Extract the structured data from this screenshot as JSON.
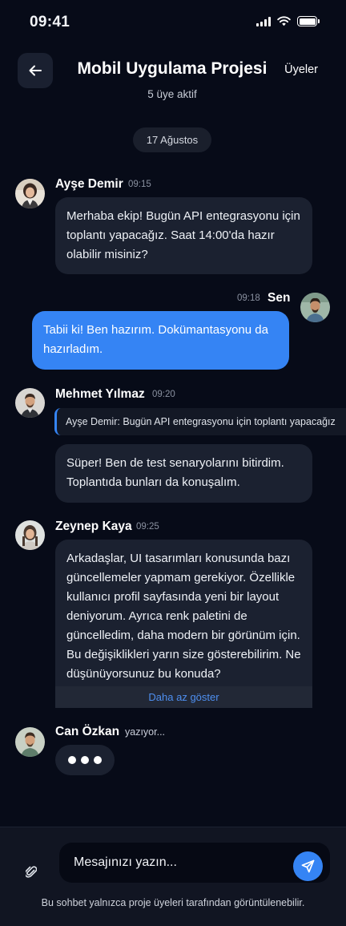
{
  "status_bar": {
    "time": "09:41"
  },
  "header": {
    "title": "Mobil Uygulama Projesi",
    "subtitle": "5 üye aktif",
    "members_label": "Üyeler"
  },
  "date_separator": "17 Ağustos",
  "messages": [
    {
      "sender": "Ayşe Demir",
      "time": "09:15",
      "text": "Merhaba ekip! Bugün API entegrasyonu için toplantı yapacağız. Saat 14:00'da hazır olabilir misiniz?"
    },
    {
      "sender": "Sen",
      "time": "09:18",
      "text": "Tabii ki! Ben hazırım. Dokümantasyonu da hazırladım."
    },
    {
      "sender": "Mehmet Yılmaz",
      "time": "09:20",
      "reply_to": "Ayşe Demir: Bugün API entegrasyonu için toplantı yapacağız",
      "text": "Süper! Ben de test senaryolarını bitirdim. Toplantıda bunları da konuşalım."
    },
    {
      "sender": "Zeynep Kaya",
      "time": "09:25",
      "text": "Arkadaşlar, UI tasarımları konusunda bazı güncellemeler yapmam gerekiyor. Özellikle kullanıcı profil sayfasında yeni bir layout deniyorum. Ayrıca renk paletini de güncelledim, daha modern bir görünüm için. Bu değişiklikleri yarın size gösterebilirim. Ne düşünüyorsunuz bu konuda? Feedback'lerinizi bekliyorum.",
      "toggle_label": "Daha az göster"
    }
  ],
  "typing": {
    "sender": "Can Özkan",
    "label": "yazıyor..."
  },
  "composer": {
    "placeholder": "Mesajınızı yazın...",
    "footer_note": "Bu sohbet yalnızca proje üyeleri tarafından görüntülenebilir."
  },
  "colors": {
    "background": "#070b18",
    "bubble": "#1b2130",
    "accent": "#3584f4"
  },
  "icons": {
    "back": "arrow-left-icon",
    "attach": "paperclip-icon",
    "send": "send-icon"
  }
}
